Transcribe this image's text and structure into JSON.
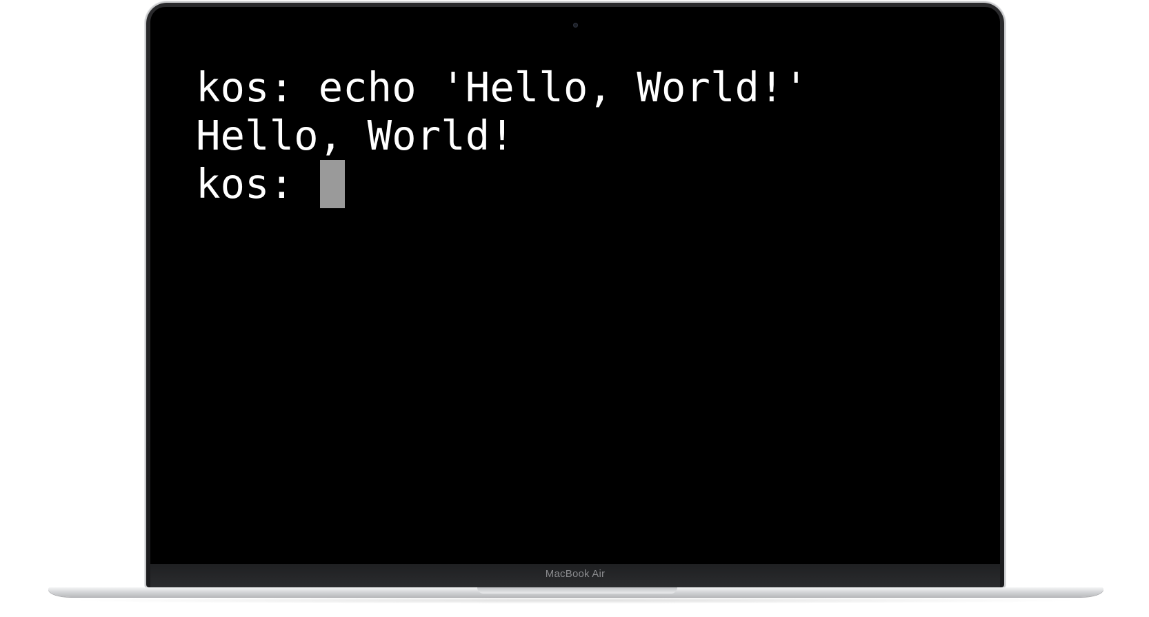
{
  "device": {
    "model_label": "MacBook Air"
  },
  "terminal": {
    "background": "#000000",
    "text_color": "#ffffff",
    "cursor_color": "#9a9a9a",
    "lines": [
      {
        "text": "kos: echo 'Hello, World!'"
      },
      {
        "text": "Hello, World!"
      }
    ],
    "prompt": {
      "text": "kos: "
    }
  }
}
